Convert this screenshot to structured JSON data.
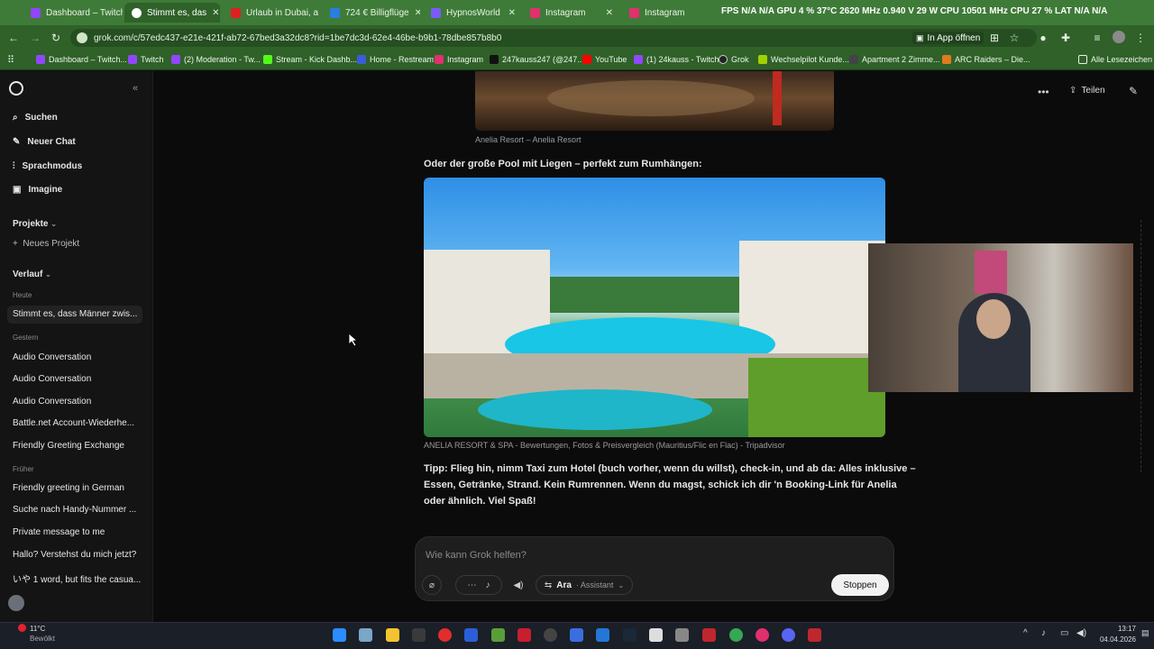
{
  "tabs": [
    {
      "label": "Dashboard – Twitch",
      "color": "#9146ff"
    },
    {
      "label": "Stimmt es, das",
      "color": "#ffffff"
    },
    {
      "label": "Urlaub in Dubai, a",
      "color": "#e02020"
    },
    {
      "label": "724 € Billigflüge",
      "color": "#2a7de1"
    },
    {
      "label": "HypnosWorld",
      "color": "#7a5cf5"
    },
    {
      "label": "Instagram",
      "color": "#e1306c"
    },
    {
      "label": "Instagram",
      "color": "#e1306c"
    }
  ],
  "overlay_text": "FPS N/A N/A GPU 4 % 37°C 2620 MHz 0.940 V 29 W CPU 10501 MHz CPU 27 % LAT N/A N/A",
  "address": {
    "url": "grok.com/c/57edc437-e21e-421f-ab72-67bed3a32dc8?rid=1be7dc3d-62e4-46be-b9b1-78dbe857b8b0",
    "app_open": "In App öffnen"
  },
  "bookmarks": [
    {
      "label": "Dashboard – Twitch...",
      "color": "#9146ff"
    },
    {
      "label": "Twitch",
      "color": "#9146ff"
    },
    {
      "label": "(2) Moderation - Tw...",
      "color": "#9146ff"
    },
    {
      "label": "Stream - Kick Dashb...",
      "color": "#53fc18"
    },
    {
      "label": "Home - Restream",
      "color": "#3b5bdb"
    },
    {
      "label": "Instagram",
      "color": "#e1306c"
    },
    {
      "label": "247kauss247 (@247...",
      "color": "#111111"
    },
    {
      "label": "YouTube",
      "color": "#ff0000"
    },
    {
      "label": "(1) 24kauss - Twitch",
      "color": "#9146ff"
    },
    {
      "label": "Grok",
      "color": "#222222"
    },
    {
      "label": "Wechselpilot Kunde...",
      "color": "#a3d100"
    },
    {
      "label": "Apartment 2 Zimme...",
      "color": "#444444"
    },
    {
      "label": "ARC Raiders – Die...",
      "color": "#e07a20"
    },
    {
      "label": "Alle Lesezeichen",
      "color": "#555555"
    }
  ],
  "sidebar": {
    "nav": [
      {
        "label": "Suchen",
        "icon": "search-icon"
      },
      {
        "label": "Neuer Chat",
        "icon": "compose-icon"
      },
      {
        "label": "Sprachmodus",
        "icon": "waveform-icon"
      },
      {
        "label": "Imagine",
        "icon": "image-icon"
      }
    ],
    "projects_label": "Projekte",
    "new_project": "Neues Projekt",
    "history_label": "Verlauf",
    "today_label": "Heute",
    "today": [
      "Stimmt es, dass Männer zwis..."
    ],
    "yesterday_label": "Gestern",
    "yesterday": [
      "Audio Conversation",
      "Audio Conversation",
      "Audio Conversation",
      "Battle.net Account-Wiederhe...",
      "Friendly Greeting Exchange"
    ],
    "earlier_label": "Früher",
    "earlier": [
      "Friendly greeting in German",
      "Suche nach Handy-Nummer ...",
      "Private message to me",
      "Hallo? Verstehst du mich jetzt?",
      "いや 1 word, but fits the casua..."
    ]
  },
  "main": {
    "top_caption": "Anelia Resort – Anelia Resort",
    "pool_heading": "Oder der große Pool mit Liegen – perfekt zum Rumhängen:",
    "image_caption": "ANELIA RESORT & SPA - Bewertungen, Fotos & Preisvergleich (Mauritius/Flic  en Flac) - Tripadvisor",
    "tip_line1": "Tipp: Flieg hin, nimm Taxi zum Hotel (buch vorher, wenn du willst), check-in, und ab da: Alles inklusive –",
    "tip_line2": "Essen, Getränke, Strand. Kein Rumrennen. Wenn du magst, schick ich dir 'n Booking-Link für Anelia",
    "tip_line3": "oder ähnlich. Viel Spaß!",
    "share_label": "Teilen"
  },
  "composer": {
    "placeholder": "Wie kann Grok helfen?",
    "voice_name": "Ara",
    "voice_role": "· Assistant",
    "stop_label": "Stoppen"
  },
  "taskbar": {
    "weather_temp": "11°C",
    "weather_desc": "Bewölkt",
    "time": "13:17",
    "date": "04.04.2026"
  }
}
